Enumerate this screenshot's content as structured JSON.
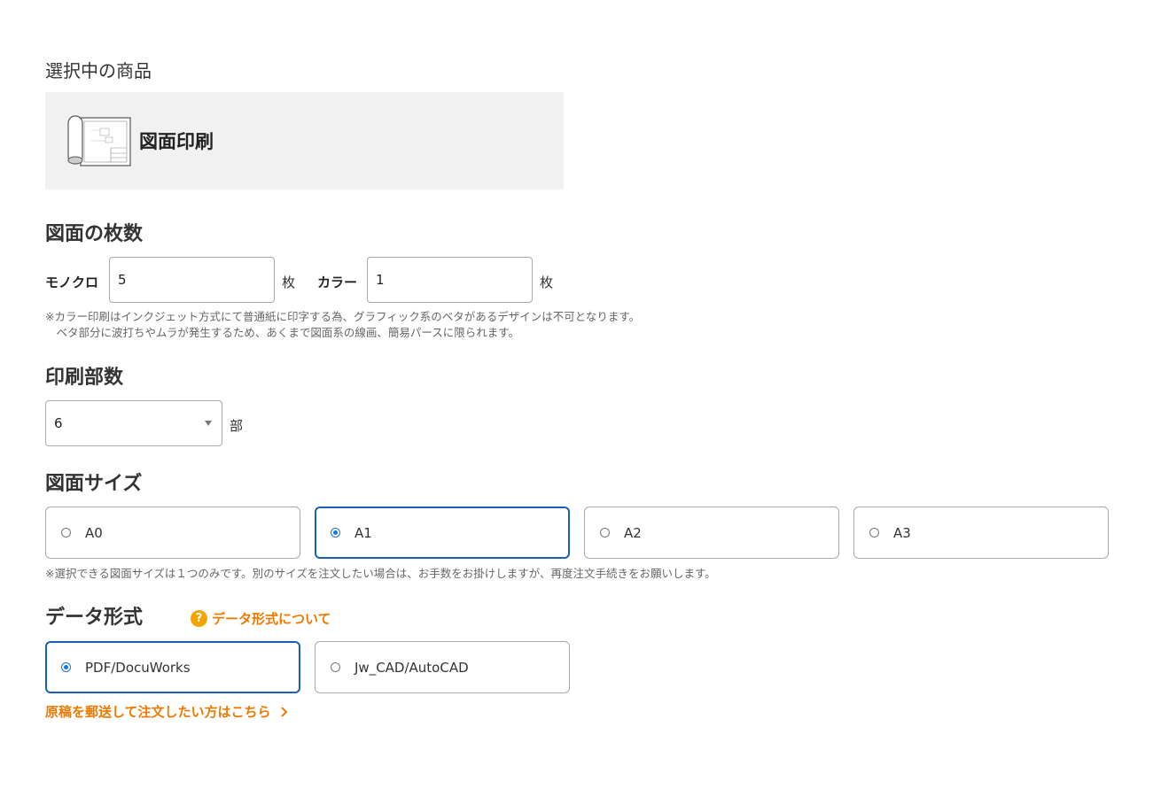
{
  "selected_product": {
    "heading": "選択中の商品",
    "name": "図面印刷",
    "icon": "blueprint-roll-icon"
  },
  "sheet_count": {
    "heading": "図面の枚数",
    "mono_label": "モノクロ",
    "mono_value": "5",
    "color_label": "カラー",
    "color_value": "1",
    "unit": "枚",
    "note_line1": "※カラー印刷はインクジェット方式にて普通紙に印字する為、グラフィック系のベタがあるデザインは不可となります。",
    "note_line2": "　ベタ部分に波打ちやムラが発生するため、あくまで図面系の線画、簡易パースに限られます。"
  },
  "copies": {
    "heading": "印刷部数",
    "value": "6",
    "unit": "部"
  },
  "paper_size": {
    "heading": "図面サイズ",
    "options": [
      {
        "label": "A0",
        "selected": false
      },
      {
        "label": "A1",
        "selected": true
      },
      {
        "label": "A2",
        "selected": false
      },
      {
        "label": "A3",
        "selected": false
      }
    ],
    "note": "※選択できる図面サイズは１つのみです。別のサイズを注文したい場合は、お手数をお掛けしますが、再度注文手続きをお願いします。"
  },
  "data_format": {
    "heading": "データ形式",
    "help_link": "データ形式について",
    "options": [
      {
        "label": "PDF/DocuWorks",
        "selected": true
      },
      {
        "label": "Jw_CAD/AutoCAD",
        "selected": false
      }
    ],
    "mail_link": "原稿を郵送して注文したい方はこちら"
  },
  "colors": {
    "accent_orange": "#ee7800",
    "selected_border": "#1a5fb4",
    "help_badge": "#f5a300",
    "product_bg": "#f1f1f1"
  }
}
